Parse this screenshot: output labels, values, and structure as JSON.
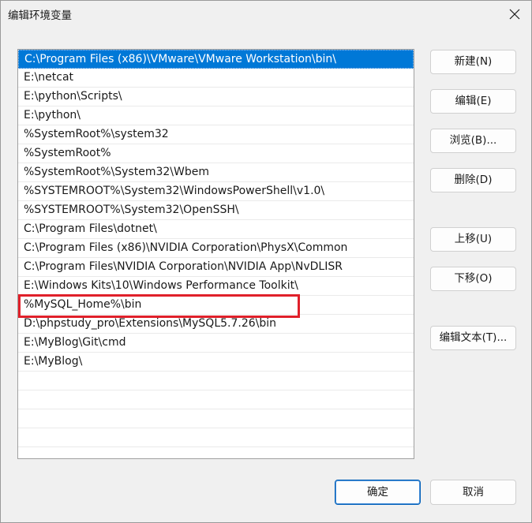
{
  "window": {
    "title": "编辑环境变量"
  },
  "path_list": {
    "items": [
      "C:\\Program Files (x86)\\VMware\\VMware Workstation\\bin\\",
      "E:\\netcat",
      "E:\\python\\Scripts\\",
      "E:\\python\\",
      "%SystemRoot%\\system32",
      "%SystemRoot%",
      "%SystemRoot%\\System32\\Wbem",
      "%SYSTEMROOT%\\System32\\WindowsPowerShell\\v1.0\\",
      "%SYSTEMROOT%\\System32\\OpenSSH\\",
      "C:\\Program Files\\dotnet\\",
      "C:\\Program Files (x86)\\NVIDIA Corporation\\PhysX\\Common",
      "C:\\Program Files\\NVIDIA Corporation\\NVIDIA App\\NvDLISR",
      "E:\\Windows Kits\\10\\Windows Performance Toolkit\\",
      "%MySQL_Home%\\bin",
      "D:\\phpstudy_pro\\Extensions\\MySQL5.7.26\\bin",
      "E:\\MyBlog\\Git\\cmd",
      "E:\\MyBlog\\"
    ],
    "selected_index": 0,
    "highlighted_index": 13,
    "empty_rows": 5
  },
  "buttons": {
    "new": "新建(N)",
    "edit": "编辑(E)",
    "browse": "浏览(B)...",
    "delete": "删除(D)",
    "move_up": "上移(U)",
    "move_down": "下移(O)",
    "edit_text": "编辑文本(T)...",
    "ok": "确定",
    "cancel": "取消"
  },
  "colors": {
    "selection": "#0078d7",
    "highlight_box": "#e0202a"
  }
}
